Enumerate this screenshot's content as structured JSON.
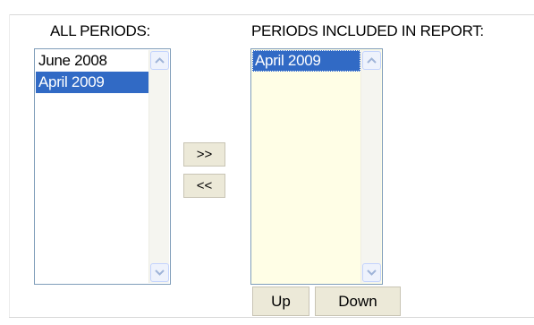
{
  "all_periods": {
    "label": "ALL PERIODS:",
    "items": [
      {
        "text": "June 2008",
        "selected": false
      },
      {
        "text": "April 2009",
        "selected": true
      }
    ]
  },
  "included_periods": {
    "label": "PERIODS INCLUDED IN REPORT:",
    "background_color": "#fffee6",
    "items": [
      {
        "text": "April 2009",
        "selected": true
      }
    ]
  },
  "transfer_buttons": {
    "add_label": ">>",
    "remove_label": "<<"
  },
  "order_buttons": {
    "up_label": "Up",
    "down_label": "Down"
  },
  "colors": {
    "selection": "#316ac5",
    "button_face": "#ece9d8"
  },
  "icons": {
    "scroll_up": "chevron-up-icon",
    "scroll_down": "chevron-down-icon"
  }
}
